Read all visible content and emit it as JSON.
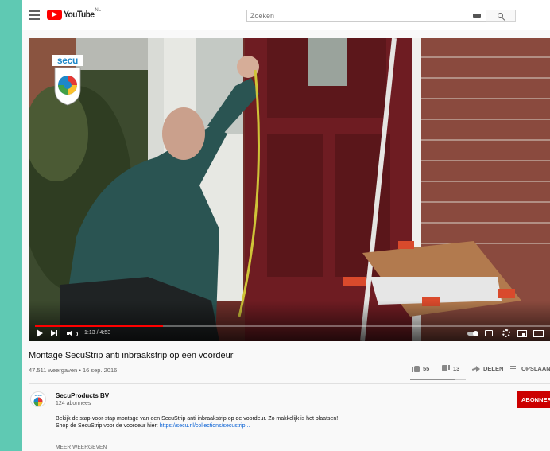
{
  "masthead": {
    "logo_word": "YouTube",
    "region": "NL",
    "search_placeholder": "Zoeken"
  },
  "player": {
    "time": "1:13 / 4:53",
    "progress": 0.249,
    "overlay_logo": "secu"
  },
  "video": {
    "title": "Montage SecuStrip anti inbraakstrip op een voordeur",
    "views_date": "47.511 weergaven • 16 sep. 2016",
    "likes": "55",
    "dislikes": "13",
    "share_label": "DELEN",
    "save_label": "OPSLAAN",
    "like_ratio": 0.81
  },
  "channel": {
    "avatar_word": "secu",
    "name": "SecuProducts BV",
    "subscribers": "124 abonnees",
    "subscribe_label": "ABONNEREN"
  },
  "description": {
    "line1": "Bekijk de stap-voor-stap montage van een SecuStrip anti inbraakstrip op de voordeur. Zo makkelijk is het plaatsen!",
    "line2_prefix": "Shop de SecuStrip voor de voordeur hier: ",
    "link": "https://secu.nl/collections/secustrip...",
    "more_label": "MEER WEERGEVEN"
  },
  "colors": {
    "brand_red": "#ff0000",
    "subscribe_red": "#cc0000",
    "link_blue": "#065fd4",
    "page_border": "#5fc9b3"
  }
}
